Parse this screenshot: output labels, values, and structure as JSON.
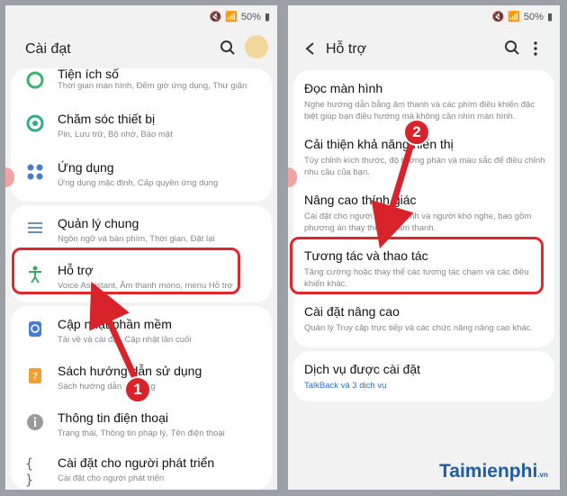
{
  "status": {
    "battery": "50%"
  },
  "left": {
    "title": "Cài đạt",
    "items": [
      {
        "title": "Tiện ích số",
        "sub": "Thời gian màn hình, Đếm giờ ứng dụng, Thư giãn",
        "icon": "digital-wellbeing-icon"
      },
      {
        "title": "Chăm sóc thiết bị",
        "sub": "Pin, Lưu trữ, Bộ nhớ, Bảo mật",
        "icon": "device-care-icon"
      },
      {
        "title": "Ứng dụng",
        "sub": "Ứng dụng mặc định, Cấp quyền ứng dụng",
        "icon": "apps-icon"
      },
      {
        "title": "Quản lý chung",
        "sub": "Ngôn ngữ và bàn phím, Thời gian, Đặt lại",
        "icon": "general-management-icon"
      },
      {
        "title": "Hỗ trợ",
        "sub": "Voice Assistant, Âm thanh mono, menu Hỗ trợ",
        "icon": "accessibility-icon"
      },
      {
        "title": "Cập nhật phần mềm",
        "sub": "Tải về và cài đặt, Cập nhật lần cuối",
        "icon": "software-update-icon"
      },
      {
        "title": "Sách hướng dẫn sử dụng",
        "sub": "Sách hướng dẫn sử dụng",
        "icon": "user-manual-icon"
      },
      {
        "title": "Thông tin điện thoại",
        "sub": "Trạng thái, Thông tin pháp lý, Tên điện thoại",
        "icon": "info-icon"
      },
      {
        "title": "Cài đặt cho người phát triển",
        "sub": "Cài đặt cho người phát triển",
        "icon": "developer-options-icon"
      }
    ]
  },
  "right": {
    "title": "Hỗ trợ",
    "items": [
      {
        "title": "Đọc màn hình",
        "sub1": "Nghe hướng dẫn bằng âm thanh và các phím điều khiển đặc",
        "sub2": "biệt giúp bạn điều hướng mà không cần nhìn màn hình."
      },
      {
        "title": "Cải thiện khả năng hiển thị",
        "sub1": "Tùy chỉnh kích thước, độ tương phản và màu sắc để điều chỉnh",
        "sub2": "nhu cầu của bạn."
      },
      {
        "title": "Nâng cao thính giác",
        "sub1": "Cài đặt cho người khiếm thính và người khó nghe, bao gồm",
        "sub2": "phương án thay thế cho âm thanh."
      },
      {
        "title": "Tương tác và thao tác",
        "sub1": "Tăng cường hoặc thay thế các tương tác chạm và các điều",
        "sub2": "khiển khác."
      },
      {
        "title": "Cài đặt nâng cao",
        "sub1": "Quản lý Truy cập trực tiếp và các chức năng nâng cao khác.",
        "sub2": ""
      },
      {
        "title": "Dịch vụ được cài đặt",
        "sub1": "TalkBack và 3 dịch vụ",
        "sub2": ""
      }
    ]
  },
  "badges": [
    "1",
    "2"
  ],
  "watermark": {
    "main": "Taimienphi",
    "suffix": ".vn"
  }
}
